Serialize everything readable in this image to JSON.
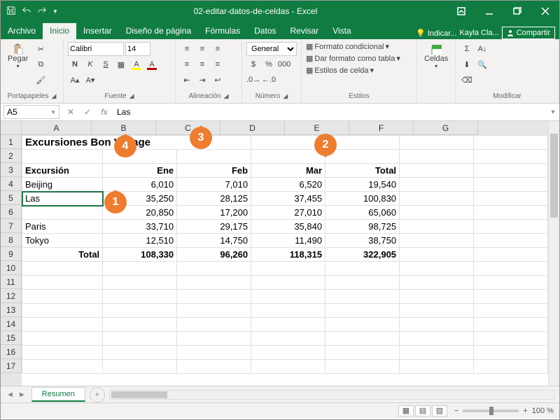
{
  "titlebar": {
    "title": "02-editar-datos-de-celdas - Excel"
  },
  "tabs": {
    "items": [
      "Archivo",
      "Inicio",
      "Insertar",
      "Diseño de página",
      "Fórmulas",
      "Datos",
      "Revisar",
      "Vista"
    ],
    "active": 1,
    "tell_me": "Indicar...",
    "user": "Kayla Cla...",
    "share": "Compartir"
  },
  "ribbon": {
    "clipboard": {
      "paste": "Pegar",
      "label": "Portapapeles"
    },
    "font": {
      "name": "Calibri",
      "size": "14",
      "label": "Fuente"
    },
    "alignment": {
      "label": "Alineación"
    },
    "number": {
      "format": "General",
      "label": "Número"
    },
    "styles": {
      "conditional": "Formato condicional",
      "table": "Dar formato como tabla",
      "cell": "Estilos de celda",
      "label": "Estilos"
    },
    "cells": {
      "label": "Celdas"
    },
    "editing": {
      "label": "Modificar"
    }
  },
  "formulabar": {
    "namebox": "A5",
    "value": "Las "
  },
  "grid": {
    "columns": [
      "A",
      "B",
      "C",
      "D",
      "E",
      "F",
      "G"
    ],
    "title": "Excursiones Bon Voyage",
    "headers": [
      "Excursión",
      "Ene",
      "Feb",
      "Mar",
      "Total"
    ],
    "rows": [
      {
        "a": "Beijing",
        "b": "6,010",
        "c": "7,010",
        "d": "6,520",
        "e": "19,540"
      },
      {
        "a": "Las ",
        "b": "35,250",
        "c": "28,125",
        "d": "37,455",
        "e": "100,830"
      },
      {
        "a": "",
        "b": "20,850",
        "c": "17,200",
        "d": "27,010",
        "e": "65,060"
      },
      {
        "a": "Paris",
        "b": "33,710",
        "c": "29,175",
        "d": "35,840",
        "e": "98,725"
      },
      {
        "a": "Tokyo",
        "b": "12,510",
        "c": "14,750",
        "d": "11,490",
        "e": "38,750"
      }
    ],
    "totals": {
      "label": "Total",
      "b": "108,330",
      "c": "96,260",
      "d": "118,315",
      "e": "322,905"
    },
    "row_labels": [
      "1",
      "2",
      "3",
      "4",
      "5",
      "6",
      "7",
      "8",
      "9",
      "10",
      "11",
      "12",
      "13",
      "14",
      "15",
      "16",
      "17"
    ]
  },
  "sheet_tabs": {
    "active": "Resumen"
  },
  "statusbar": {
    "zoom": "100 %"
  },
  "callouts": {
    "c1": "1",
    "c2": "2",
    "c3": "3",
    "c4": "4"
  }
}
